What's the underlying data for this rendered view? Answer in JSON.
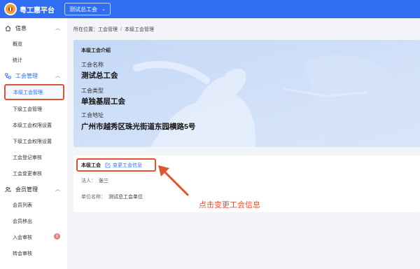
{
  "header": {
    "app_title": "粤工惠平台",
    "org_selector": "测试总工会",
    "colors": {
      "bar": "#2f6df3"
    }
  },
  "sidebar": {
    "groups": [
      {
        "label": "信息",
        "icon": "home-icon",
        "items": [
          "概览",
          "统计"
        ]
      },
      {
        "label": "工会管理",
        "icon": "org-icon",
        "items": [
          "本级工会管理",
          "下级工会管理",
          "本级工会权限设置",
          "下级工会权限设置",
          "工会登记审核",
          "工会变更审核"
        ]
      },
      {
        "label": "会员管理",
        "icon": "users-icon",
        "items": [
          "会员列表",
          "会员移出",
          "入会审核",
          "转会审核"
        ]
      }
    ],
    "active_item": "本级工会管理",
    "join_review_badge": "8"
  },
  "breadcrumb": {
    "prefix": "所在位置：",
    "level1": "工会管理",
    "separator": "/",
    "level2": "本级工会管理"
  },
  "intro": {
    "title": "本级工会介绍",
    "name_label": "工会名称",
    "name_value": "测试总工会",
    "type_label": "工会类型",
    "type_value": "单独基层工会",
    "address_label": "工会地址",
    "address_value": "广州市越秀区珠光街道东园横路5号"
  },
  "info": {
    "title": "本级工会",
    "edit_label": "变更工会信息",
    "legal_label": "法人：",
    "legal_value": "张三",
    "unit_label": "单位名称：",
    "unit_value": "测试总工会单位"
  },
  "annotation": {
    "text": "点击变更工会信息",
    "color": "#e0542f"
  }
}
